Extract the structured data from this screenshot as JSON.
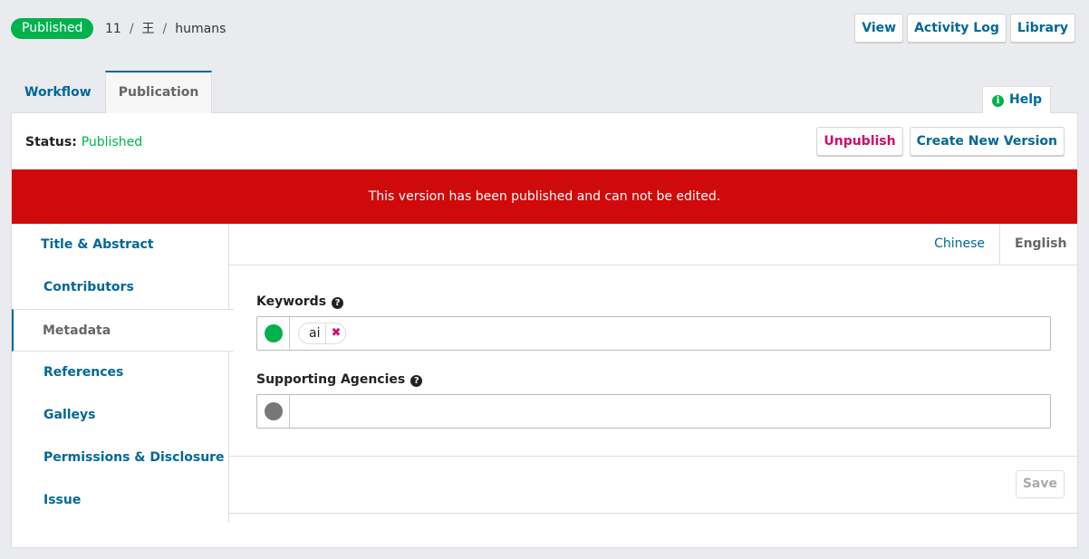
{
  "header": {
    "status_pill": "Published",
    "breadcrumb": {
      "id": "11",
      "author": "王",
      "title": "humans",
      "separator": "/"
    },
    "actions": {
      "view": "View",
      "activity_log": "Activity Log",
      "library": "Library"
    }
  },
  "tabs": {
    "workflow": "Workflow",
    "publication": "Publication",
    "help": "Help"
  },
  "panel": {
    "status_label": "Status:",
    "status_value": "Published",
    "unpublish": "Unpublish",
    "create_version": "Create New Version",
    "banner": "This version has been published and can not be edited."
  },
  "sidebar": {
    "items": [
      {
        "label": "Title & Abstract"
      },
      {
        "label": "Contributors"
      },
      {
        "label": "Metadata"
      },
      {
        "label": "References"
      },
      {
        "label": "Galleys"
      },
      {
        "label": "Permissions & Disclosure"
      },
      {
        "label": "Issue"
      }
    ]
  },
  "languages": {
    "chinese": "Chinese",
    "english": "English"
  },
  "form": {
    "keywords_label": "Keywords",
    "keywords": [
      "ai"
    ],
    "remove_glyph": "✖",
    "help_glyph": "?",
    "supporting_label": "Supporting Agencies",
    "supporting_value": "",
    "save": "Save"
  },
  "colors": {
    "accent": "#006798",
    "success": "#00b24e",
    "danger": "#d00a6c",
    "banner": "#d00a0a"
  }
}
